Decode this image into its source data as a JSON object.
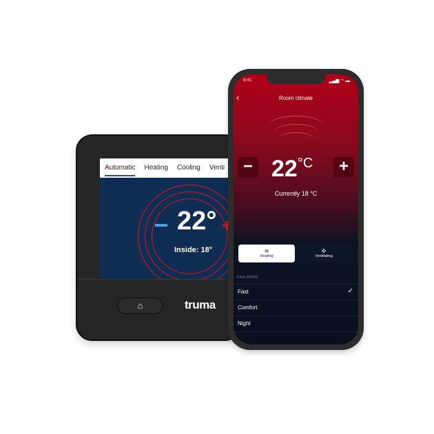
{
  "panel": {
    "tabs": [
      "Automatic",
      "Heating",
      "Cooling",
      "Venti"
    ],
    "active_tab": "Automatic",
    "minus": "−",
    "plus": "+",
    "temperature": "22°",
    "inside_label": "Inside:",
    "inside_value": "18°",
    "home_icon": "home-icon",
    "brand": "truma",
    "accent": "#e0141c"
  },
  "phone": {
    "time": "9:41",
    "status_icons": "▂▄▆ ◠ ▬",
    "title": "Room climate",
    "back": "‹",
    "minus": "−",
    "plus": "+",
    "temperature": "22",
    "unit": "°C",
    "current": "Currently 18 °C",
    "modes": [
      {
        "label": "Heating",
        "icon": "heating-icon",
        "glyph": "≋",
        "selected": true
      },
      {
        "label": "Ventilating",
        "icon": "fan-icon",
        "glyph": "✣",
        "selected": false
      }
    ],
    "fan_mode_label": "FAN MODE",
    "fan_modes": [
      {
        "label": "Fast",
        "selected": true
      },
      {
        "label": "Comfort",
        "selected": false
      },
      {
        "label": "Night",
        "selected": false
      }
    ],
    "check": "✓"
  }
}
